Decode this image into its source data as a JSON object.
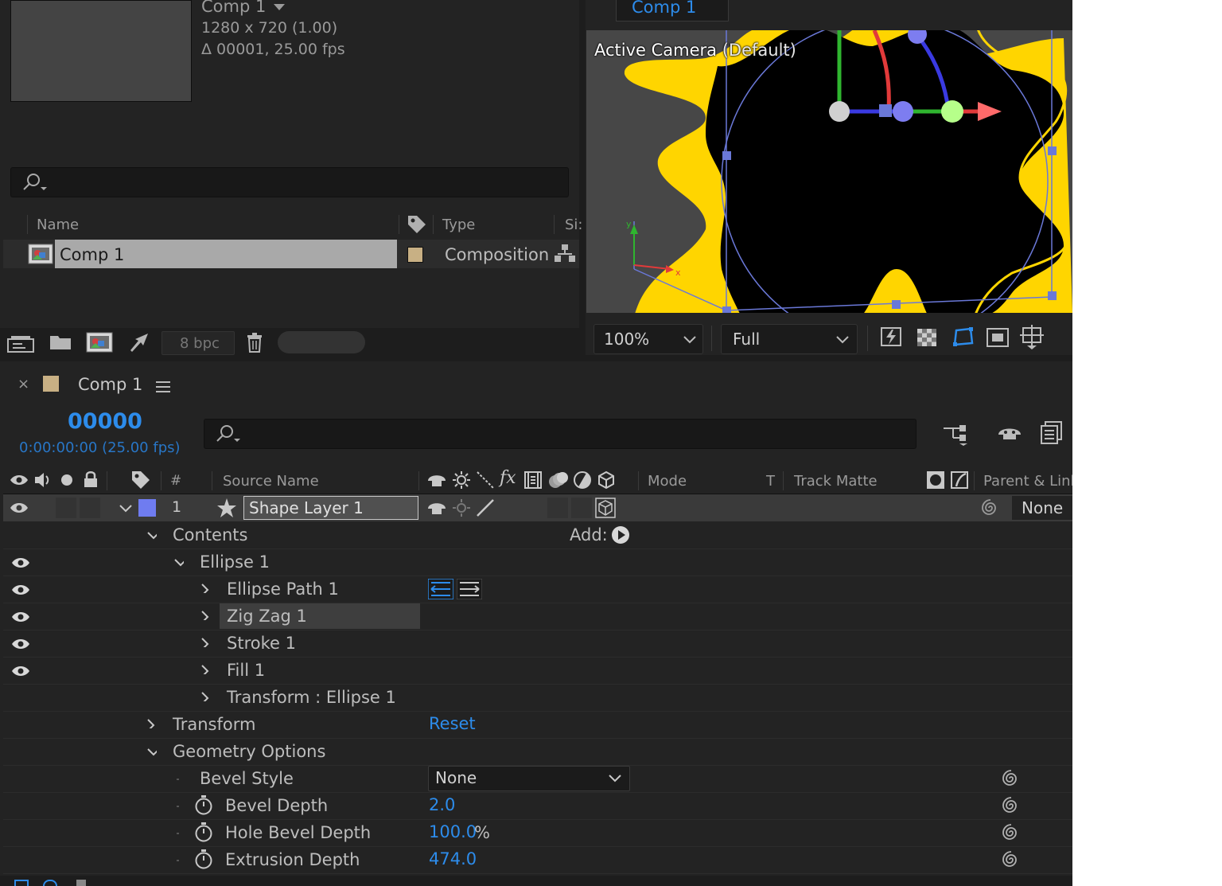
{
  "project": {
    "comp_name": "Comp 1",
    "resolution": "1280 x 720 (1.00)",
    "duration": "Δ 00001, 25.00 fps",
    "search_placeholder": "",
    "columns": {
      "name": "Name",
      "type": "Type",
      "size": "Si:"
    },
    "item": {
      "name": "Comp 1",
      "type": "Composition",
      "label_color": "#c8b084"
    },
    "bpc": "8 bpc"
  },
  "viewer": {
    "tab": "Comp 1",
    "camera_label": "Active Camera",
    "camera_sub": "(Default)",
    "zoom": "100%",
    "resolution": "Full",
    "axis_x": "x",
    "axis_y": "y"
  },
  "timeline": {
    "comp_tab": "Comp 1",
    "timecode": "00000",
    "timecode_sub": "0:00:00:00 (25.00 fps)",
    "headers": {
      "hash": "#",
      "source_name": "Source Name",
      "mode": "Mode",
      "t": "T",
      "track_matte": "Track Matte",
      "parent": "Parent & Link"
    },
    "layer": {
      "number": "1",
      "name": "Shape Layer 1",
      "parent": "None",
      "label_color": "#6f7cf0"
    },
    "tree": {
      "contents": "Contents",
      "add_label": "Add:",
      "ellipse": "Ellipse 1",
      "ellipse_path": "Ellipse Path 1",
      "zigzag": "Zig Zag 1",
      "stroke": "Stroke 1",
      "fill": "Fill 1",
      "transform_ellipse": "Transform : Ellipse 1",
      "transform": "Transform",
      "transform_value": "Reset",
      "geometry": "Geometry Options",
      "bevel_style": "Bevel Style",
      "bevel_style_value": "None",
      "bevel_depth": "Bevel Depth",
      "bevel_depth_value": "2.0",
      "hole_bevel_depth": "Hole Bevel Depth",
      "hole_bevel_depth_value": "100.0",
      "hole_bevel_unit": "%",
      "extrusion_depth": "Extrusion Depth",
      "extrusion_depth_value": "474.0"
    }
  },
  "colors": {
    "accent": "#2d8ceb",
    "star_yellow": "#ffd500",
    "layer_label": "#6f7cf0"
  }
}
